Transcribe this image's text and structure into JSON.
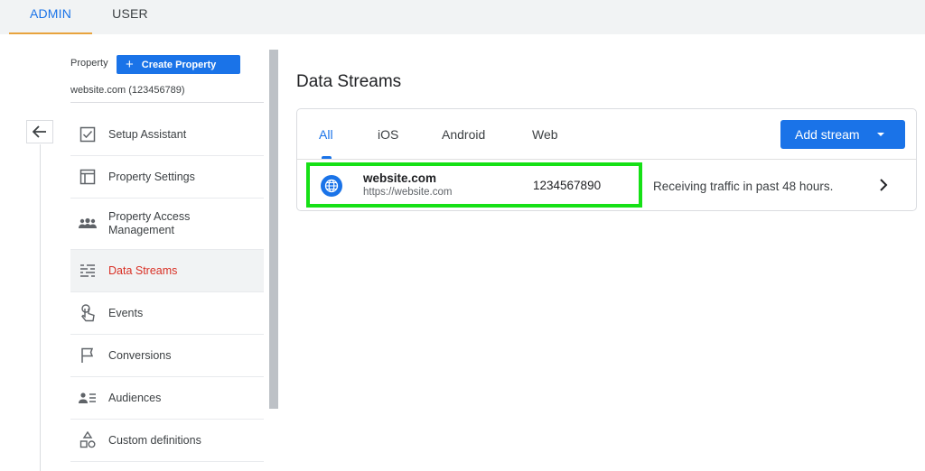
{
  "top_tabs": {
    "admin": "ADMIN",
    "user": "USER"
  },
  "sidebar": {
    "property_label": "Property",
    "create_property": "Create Property",
    "account": "website.com (123456789)",
    "items": [
      {
        "label": "Setup Assistant",
        "icon": "checkbox-icon"
      },
      {
        "label": "Property Settings",
        "icon": "layout-icon"
      },
      {
        "label": "Property Access Management",
        "icon": "people-icon"
      },
      {
        "label": "Data Streams",
        "icon": "streams-icon",
        "active": true
      },
      {
        "label": "Events",
        "icon": "touch-icon"
      },
      {
        "label": "Conversions",
        "icon": "flag-icon"
      },
      {
        "label": "Audiences",
        "icon": "audience-icon"
      },
      {
        "label": "Custom definitions",
        "icon": "shapes-icon"
      }
    ]
  },
  "main": {
    "title": "Data Streams",
    "tabs": [
      "All",
      "iOS",
      "Android",
      "Web"
    ],
    "add_stream": "Add stream",
    "streams": [
      {
        "name": "website.com",
        "url": "https://website.com",
        "id": "1234567890",
        "status": "Receiving traffic in past 48 hours."
      }
    ]
  },
  "colors": {
    "accent": "#1a73e8",
    "active_text": "#d93025",
    "highlight": "#16e016",
    "admin_underline": "#e8a33d"
  }
}
